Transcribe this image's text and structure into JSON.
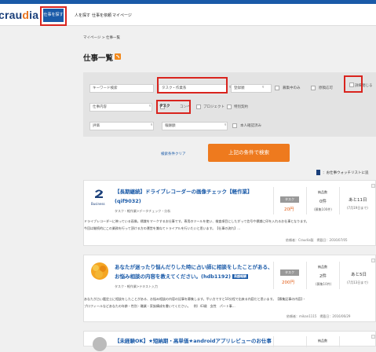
{
  "header": {
    "logo_main": "crau",
    "logo_accent": "d",
    "logo_tail": "ia",
    "nav": [
      "仕事を探す",
      "人を探す",
      "仕事を依頼",
      "マイページ"
    ]
  },
  "breadcrumb": "マイページ > 仕事一覧",
  "page_title": "仕事一覧",
  "search": {
    "keyword_placeholder": "キーワード検索",
    "task_select": "タスク・作業系",
    "register_period": "登録順",
    "only_recruiting": "募集中のみ",
    "draft_allowed": "原稿応可",
    "detail_toggle": "詳細閉じる",
    "job_content": "仕事内容",
    "type_task": "タスク",
    "type_compe": "コンペ",
    "type_project": "プロジェクト",
    "type_special": "特別契約",
    "rating": "評価",
    "reward": "報酬額",
    "identity_verified": "本人確認済み",
    "reset_label": "検索条件クリア",
    "submit_label": "上記の条件で検索"
  },
  "watch_note": "：お仕事ウォッチリストに追",
  "jobs": [
    {
      "title": "【長期継続】ドライブレコーダーの画像チェック【軽作業】",
      "title2": "(qif9032)",
      "logo_sub": "Business",
      "category": "タスク・軽作業>データチェック・分析",
      "tag": "タスク",
      "price": "20円",
      "stat_label": "納品数",
      "stat_val": "0件",
      "stat_sub": "(募集100件)",
      "deadline": "あと11日",
      "deadline_sub": "(7月19日まで)",
      "desc1": "ドライブレコーダーに映っている画像。標識をマークするお仕事です。専用のツールを使い、検査項目にしたがって信号や標識に印を入れるお仕事となります。",
      "desc2": "今回は継続的にこの業務を行って頂ける方の運営を兼ねてトライアルを行いたいと思います。【仕事の流れ】…",
      "meta": "依頼者：Craudia製　掲載日：2016/07/05"
    },
    {
      "title": "あなたが迷ったり悩んだりした時に占い師に相談をしたことがある、",
      "title2": "お悩み相談の内容を教えてください。(hdb1192)",
      "badge": "高額報酬",
      "category": "タスク・軽作業>テキスト入力",
      "tag": "タスク",
      "price": "200円",
      "stat_label": "納品数",
      "stat_val": "2件",
      "stat_sub": "(募集10件)",
      "deadline": "あと5日",
      "deadline_sub": "(7月13日まで)",
      "desc1": "あなたが占い鑑定士に相談をしたことがある、お悩み相談の内容の記事を募集します。平い方ですと10分程で出来る内容だと思います。【募集記事の内容】・",
      "desc2": "プロフィールなどあなたの年齢・性別・職業・家族構成を書いてください。　例）43歳　女性　パート事…",
      "meta": "依頼者：mikan1115　掲載日：2016/06/29"
    },
    {
      "title": "【未経験OK】★短納期・高単価★androidアプリレビューのお仕事",
      "stat_label": "納品数"
    }
  ]
}
